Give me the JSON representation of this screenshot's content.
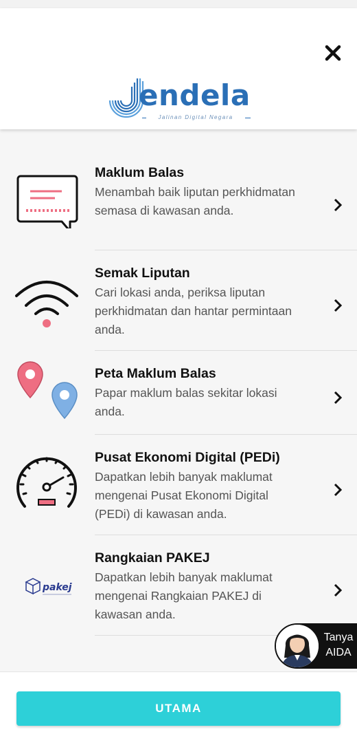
{
  "header": {
    "logo_text": "endela",
    "logo_tagline": "Jalinan Digital Negara",
    "close_icon": "close-icon"
  },
  "menu": {
    "items": [
      {
        "title": "Maklum Balas",
        "description": "Menambah baik liputan perkhidmatan semasa di kawasan anda.",
        "icon": "feedback-message-icon"
      },
      {
        "title": "Semak Liputan",
        "description": "Cari lokasi anda, periksa liputan perkhidmatan dan hantar permintaan anda.",
        "icon": "wifi-icon"
      },
      {
        "title": "Peta Maklum Balas",
        "description": "Papar maklum balas sekitar lokasi anda.",
        "icon": "map-pins-icon"
      },
      {
        "title": "Pusat Ekonomi Digital (PEDi)",
        "description": "Dapatkan lebih banyak maklumat mengenai Pusat Ekonomi Digital (PEDi) di kawasan anda.",
        "icon": "speedometer-icon"
      },
      {
        "title": "Rangkaian PAKEJ",
        "description": "Dapatkan lebih banyak maklumat mengenai Rangkaian PAKEJ di kawasan anda.",
        "icon": "pakej-logo-icon"
      }
    ]
  },
  "pakej_logo_text": "pakej",
  "assistant": {
    "label_line1": "Tanya",
    "label_line2": "AIDA"
  },
  "footer": {
    "button_label": "UTAMA"
  },
  "colors": {
    "accent": "#2dd0d8",
    "brand_blue": "#2a6fb6",
    "pink": "#ee6e82",
    "blue_pin": "#7fb0e4"
  }
}
